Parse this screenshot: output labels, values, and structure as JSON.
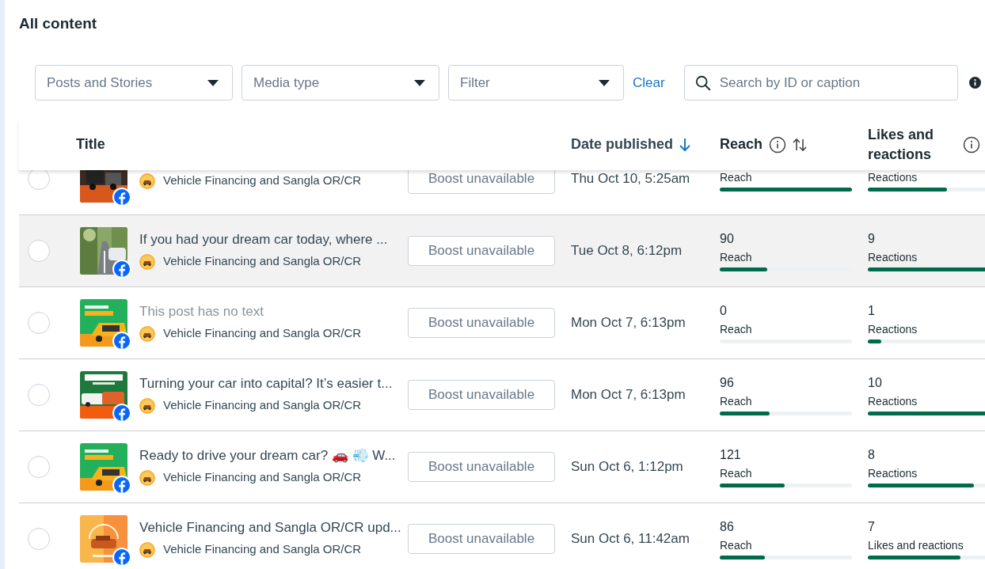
{
  "heading": "All content",
  "filters": [
    {
      "placeholder": "Posts and Stories"
    },
    {
      "placeholder": "Media type"
    },
    {
      "placeholder": "Filter"
    }
  ],
  "clear_link": "Clear",
  "search": {
    "placeholder": "Search by ID or caption"
  },
  "columns": [
    {
      "label": "Title"
    },
    {
      "label": "Date published",
      "sorted": true
    },
    {
      "label": "Reach",
      "info": true,
      "sortable": true
    },
    {
      "label": "Likes and reactions",
      "info": true
    }
  ],
  "rows": [
    {
      "selected": false,
      "highlighted": false,
      "page": "Vehicle Financing and Sangla OR/CR",
      "button": "Boost unavailable",
      "date": "Thu Oct 10, 5:25am",
      "reach": {
        "label": "Reach",
        "level": 1.0
      },
      "reactions": {
        "label": "Reactions",
        "level": 0.6
      }
    },
    {
      "selected": false,
      "highlighted": true,
      "title": "If you had your dream car today, where ...",
      "muted": false,
      "page": "Vehicle Financing and Sangla OR/CR",
      "button": "Boost unavailable",
      "date": "Tue Oct 8, 6:12pm",
      "reach": {
        "value": "90",
        "label": "Reach",
        "level": 0.36
      },
      "reactions": {
        "value": "9",
        "label": "Reactions",
        "level": 0.9
      }
    },
    {
      "selected": false,
      "highlighted": false,
      "title": "This post has no text",
      "muted": true,
      "page": "Vehicle Financing and Sangla OR/CR",
      "button": "Boost unavailable",
      "date": "Mon Oct 7, 6:13pm",
      "reach": {
        "value": "0",
        "label": "Reach",
        "level": 0
      },
      "reactions": {
        "value": "1",
        "label": "Reactions",
        "level": 0.1
      }
    },
    {
      "selected": false,
      "highlighted": false,
      "title": "Turning your car into capital? It’s easier t...",
      "muted": false,
      "page": "Vehicle Financing and Sangla OR/CR",
      "button": "Boost unavailable",
      "date": "Mon Oct 7, 6:13pm",
      "reach": {
        "value": "96",
        "label": "Reach",
        "level": 0.38
      },
      "reactions": {
        "value": "10",
        "label": "Reactions",
        "level": 1.0
      }
    },
    {
      "selected": false,
      "highlighted": false,
      "title": "Ready to drive your dream car? 🚗 💨 W...",
      "muted": false,
      "page": "Vehicle Financing and Sangla OR/CR",
      "button": "Boost unavailable",
      "date": "Sun Oct 6, 1:12pm",
      "reach": {
        "value": "121",
        "label": "Reach",
        "level": 0.49
      },
      "reactions": {
        "value": "8",
        "label": "Reactions",
        "level": 0.8
      }
    },
    {
      "selected": false,
      "highlighted": false,
      "title": "Vehicle Financing and Sangla OR/CR upd...",
      "muted": false,
      "page": "Vehicle Financing and Sangla OR/CR",
      "button": "Boost unavailable",
      "date": "Sun Oct 6, 11:42am",
      "reach": {
        "value": "86",
        "label": "Reach",
        "level": 0.34
      },
      "reactions": {
        "value": "7",
        "label": "Likes and reactions",
        "level": 0.7
      }
    }
  ]
}
